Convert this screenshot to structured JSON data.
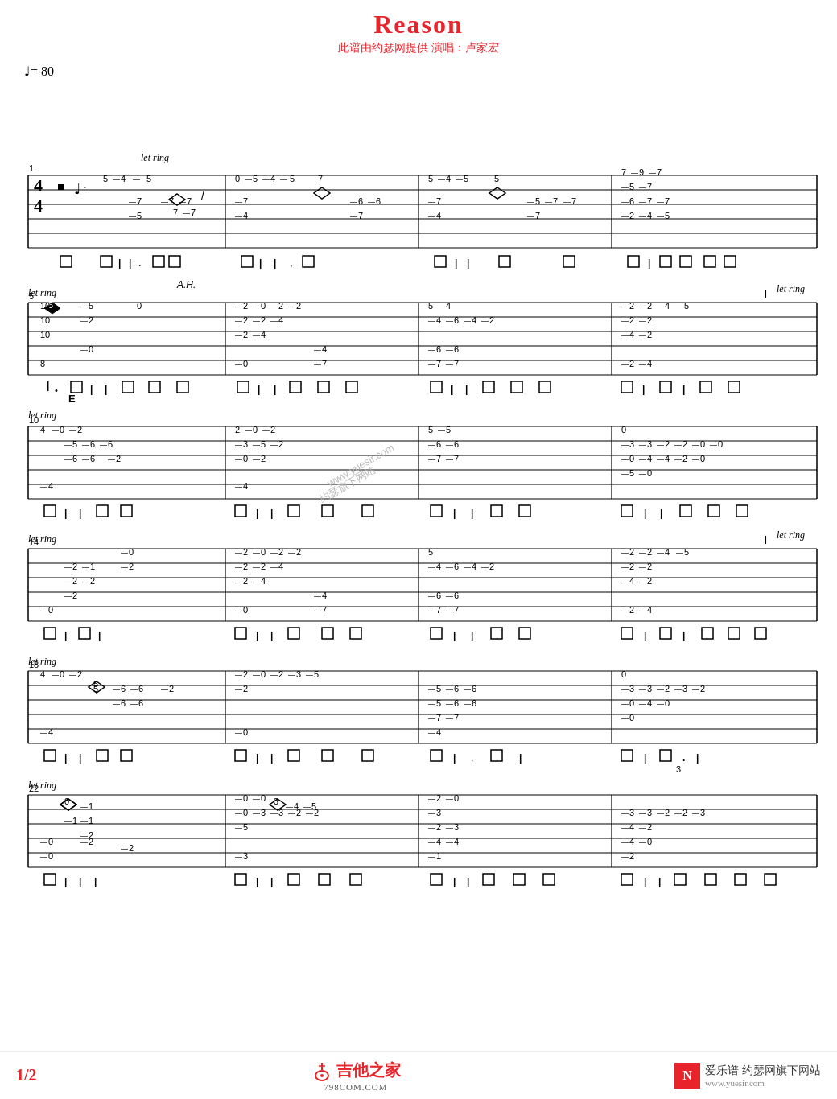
{
  "title": "Reason",
  "subtitle": "此谱由约瑟网提供   演唱：卢家宏",
  "tempo": "♩= 80",
  "page_num": "1/2",
  "footer": {
    "left_logo": "吉他之家",
    "left_sub": "798COM.COM",
    "right_logo_icon": "N",
    "right_logo_text": "爱乐谱 约瑟网旗下网站",
    "right_url": "www.yuesir.com"
  },
  "watermark": "www.yuesir.com",
  "colors": {
    "red": "#e8232a",
    "black": "#000000",
    "gray": "#888888"
  }
}
